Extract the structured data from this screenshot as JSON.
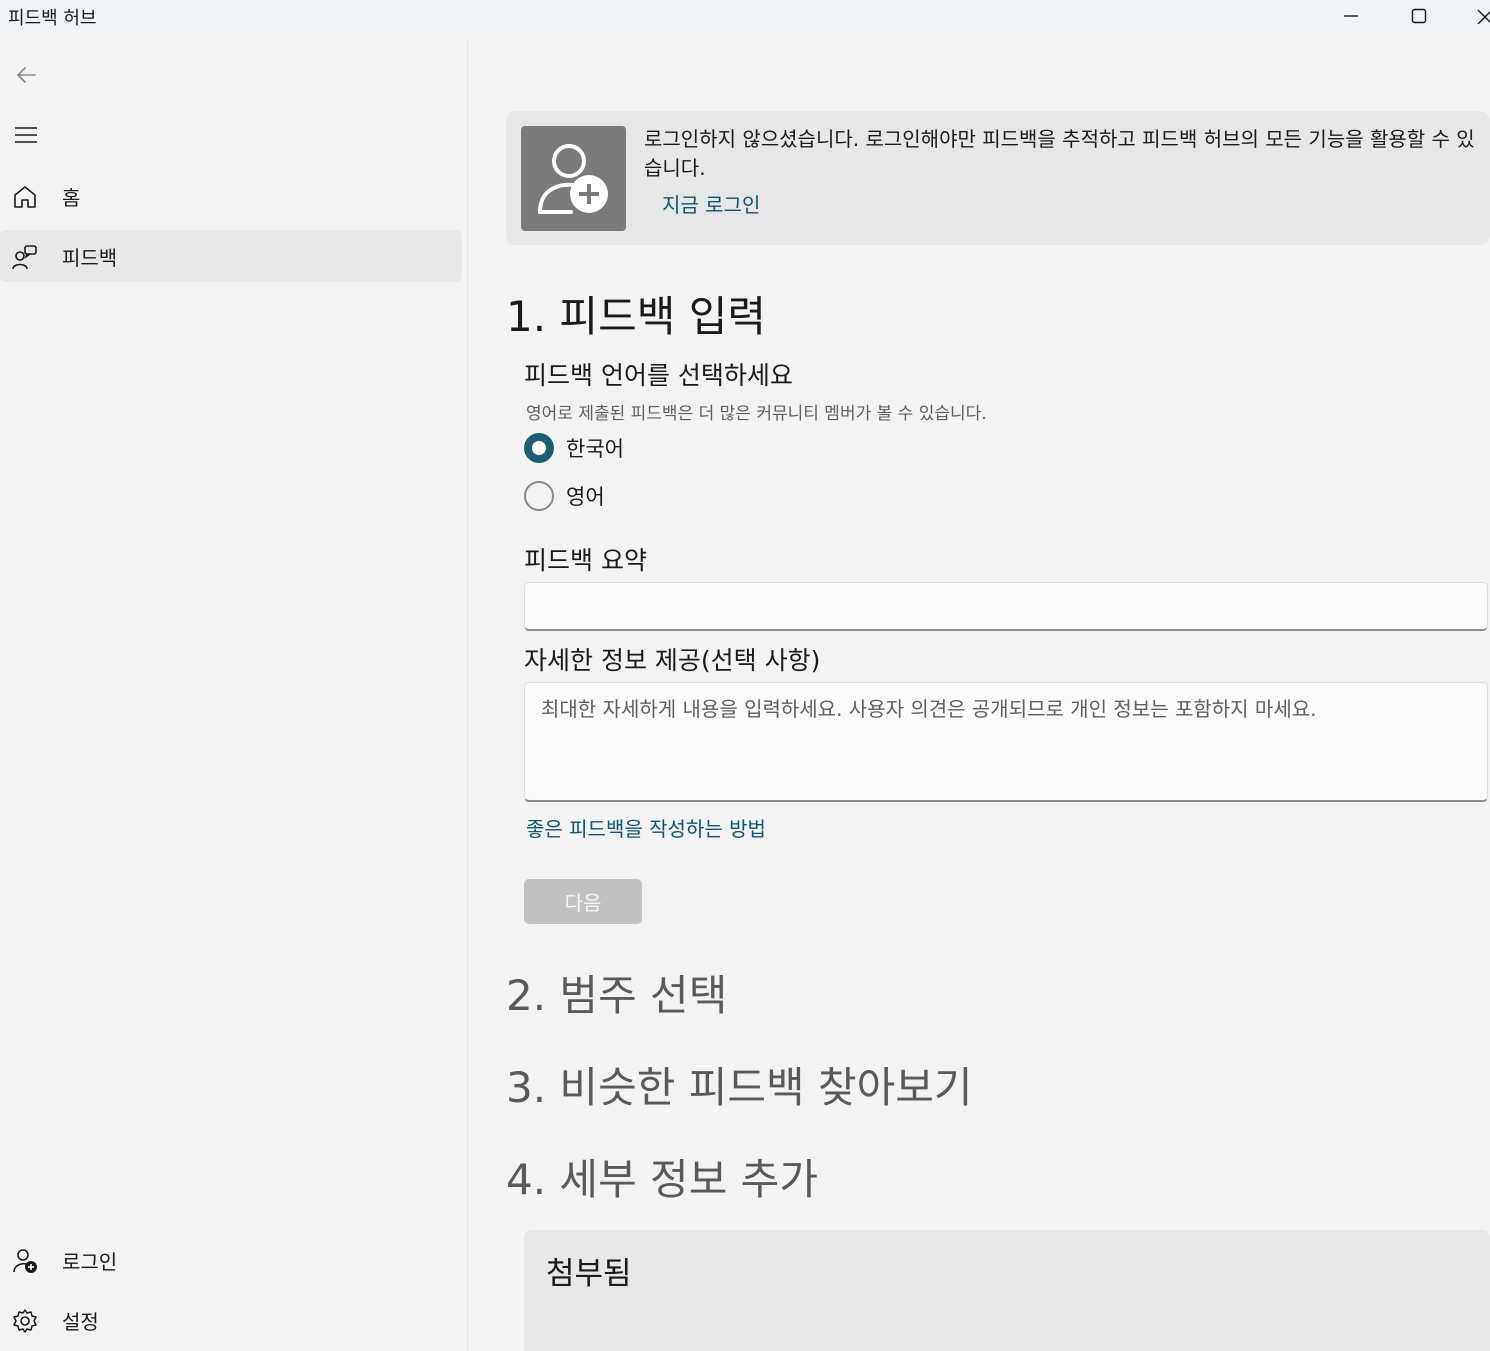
{
  "window": {
    "title": "피드백 허브",
    "controls": [
      "minimize",
      "maximize",
      "close"
    ]
  },
  "sidebar": {
    "back_icon": "back-arrow-icon",
    "menu_icon": "hamburger-icon",
    "items": [
      {
        "label": "홈",
        "icon": "home-icon",
        "active": false
      },
      {
        "label": "피드백",
        "icon": "feedback-icon",
        "active": true
      }
    ],
    "footer": [
      {
        "label": "로그인",
        "icon": "sign-in-icon"
      },
      {
        "label": "설정",
        "icon": "gear-icon"
      }
    ]
  },
  "banner": {
    "message": "로그인하지 않으셨습니다. 로그인해야만 피드백을 추적하고 피드백 허브의 모든 기능을 활용할 수 있습니다.",
    "link": "지금 로그인"
  },
  "steps": {
    "step1": "1. 피드백 입력",
    "step2": "2. 범주 선택",
    "step3": "3. 비슷한 피드백 찾아보기",
    "step4": "4. 세부 정보 추가"
  },
  "language": {
    "label": "피드백 언어를 선택하세요",
    "hint": "영어로 제출된 피드백은 더 많은 커뮤니티 멤버가 볼 수 있습니다.",
    "options": [
      {
        "label": "한국어",
        "selected": true
      },
      {
        "label": "영어",
        "selected": false
      }
    ]
  },
  "summary": {
    "label": "피드백 요약",
    "value": ""
  },
  "details": {
    "label": "자세한 정보 제공(선택 사항)",
    "placeholder": "최대한 자세하게 내용을 입력하세요. 사용자 의견은 공개되므로 개인 정보는 포함하지 마세요.",
    "help_link": "좋은 피드백을 작성하는 방법"
  },
  "next_button": "다음",
  "attachments": {
    "title": "첨부됨"
  },
  "colors": {
    "accent": "#1c5e72",
    "link": "#0f5470",
    "disabled_button": "#c2c2c2"
  }
}
